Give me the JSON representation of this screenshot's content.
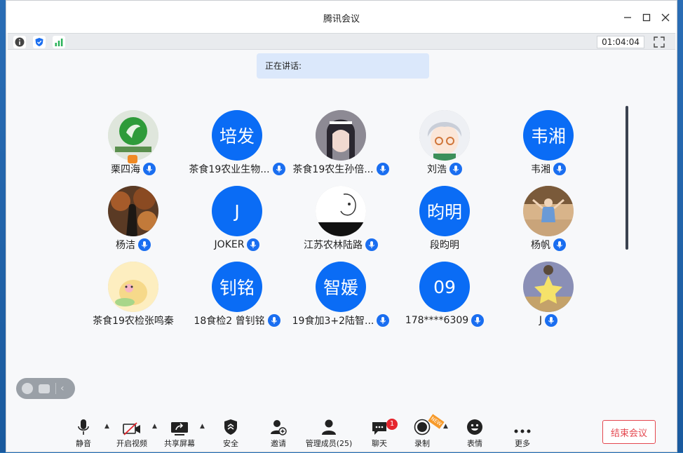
{
  "window": {
    "title": "腾讯会议"
  },
  "toolbar": {
    "timer": "01:04:04"
  },
  "speaking": {
    "label": "正在讲话:"
  },
  "participants": [
    {
      "name": "栗四海",
      "avatar_type": "photo",
      "avatar_text": "",
      "host": true,
      "mic": true
    },
    {
      "name": "茶食19农业生物...",
      "avatar_type": "text",
      "avatar_text": "培发",
      "host": false,
      "mic": true
    },
    {
      "name": "茶食19农生孙倍...",
      "avatar_type": "photo",
      "avatar_text": "",
      "host": false,
      "mic": true
    },
    {
      "name": "刘浩",
      "avatar_type": "photo",
      "avatar_text": "",
      "host": false,
      "mic": true
    },
    {
      "name": "韦湘",
      "avatar_type": "text",
      "avatar_text": "韦湘",
      "host": false,
      "mic": true
    },
    {
      "name": "杨洁",
      "avatar_type": "photo",
      "avatar_text": "",
      "host": false,
      "mic": true
    },
    {
      "name": "JOKER",
      "avatar_type": "text",
      "avatar_text": "J",
      "host": false,
      "mic": true
    },
    {
      "name": "江苏农林陆路",
      "avatar_type": "photo",
      "avatar_text": "",
      "host": false,
      "mic": true
    },
    {
      "name": "段昀明",
      "avatar_type": "text",
      "avatar_text": "昀明",
      "host": false,
      "mic": false
    },
    {
      "name": "杨帆",
      "avatar_type": "photo",
      "avatar_text": "",
      "host": false,
      "mic": true
    },
    {
      "name": "茶食19农检张鸣秦",
      "avatar_type": "photo",
      "avatar_text": "",
      "host": false,
      "mic": false
    },
    {
      "name": "18食检2 曾钊铭",
      "avatar_type": "text",
      "avatar_text": "钊铭",
      "host": false,
      "mic": true
    },
    {
      "name": "19食加3+2陆智...",
      "avatar_type": "text",
      "avatar_text": "智媛",
      "host": false,
      "mic": true
    },
    {
      "name": "178****6309",
      "avatar_type": "text",
      "avatar_text": "09",
      "host": false,
      "mic": true
    },
    {
      "name": "J",
      "avatar_type": "photo",
      "avatar_text": "",
      "host": false,
      "mic": true
    }
  ],
  "bottom_bar": {
    "mute": "静音",
    "video": "开启视频",
    "share": "共享屏幕",
    "security": "安全",
    "invite": "邀请",
    "members": "管理成员(25)",
    "chat": "聊天",
    "chat_badge": "1",
    "record": "录制",
    "record_tag": "NEW",
    "emoji": "表情",
    "more": "更多",
    "end": "结束会议"
  },
  "colors": {
    "accent": "#0a6cf5",
    "end_red": "#e4474f",
    "badge_red": "#e5252d"
  }
}
